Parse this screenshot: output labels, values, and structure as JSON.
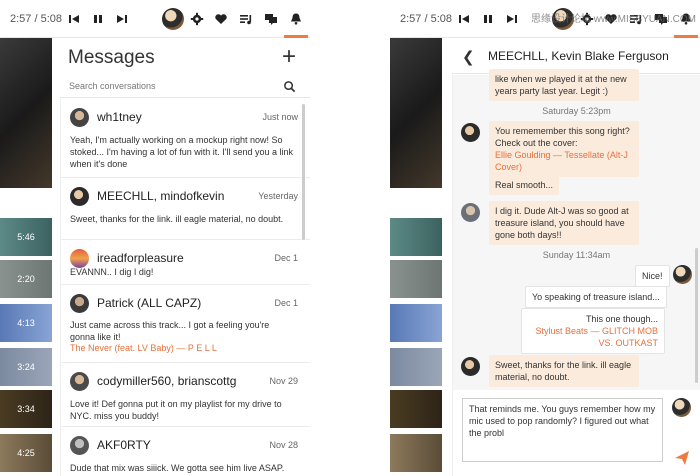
{
  "player": {
    "time_left": "2:57 / 5:08",
    "time_right": "2:57 / 5:08"
  },
  "watermark": "思缘设计论坛 www.MISSYUAN.COM",
  "strip_tiles": [
    "5:46",
    "2:20",
    "4:13",
    "3:24",
    "3:34",
    "4:25"
  ],
  "messages": {
    "title": "Messages",
    "add_label": "+",
    "search_placeholder": "Search conversations",
    "conversations": [
      {
        "name": "wh1tney",
        "date": "Just now",
        "preview": "Yeah, I'm actually working on a mockup right now! So stoked... I'm having a lot of fun with it. I'll send you a link when it's done",
        "link": ""
      },
      {
        "name": "MEECHLL, mindofkevin",
        "date": "Yesterday",
        "preview": "Sweet, thanks for the link. ill eagle material, no doubt.",
        "link": ""
      },
      {
        "name": "ireadforpleasure",
        "date": "Dec 1",
        "preview": "EVANNN.. I dig I dig!",
        "link": ""
      },
      {
        "name": "Patrick (ALL CAPZ)",
        "date": "Dec 1",
        "preview": "Just came across this track... I got a feeling you're gonna like it!",
        "link": "The Never (feat. LV Baby) — P E L L"
      },
      {
        "name": "codymiller560, brianscottg",
        "date": "Nov 29",
        "preview": "Love it! Def gonna put it on my playlist for my drive to NYC. miss you buddy!",
        "link": ""
      },
      {
        "name": "AKF0RTY",
        "date": "Nov 28",
        "preview": "Dude that mix was siiick. We gotta see him live ASAP.",
        "link": ""
      }
    ]
  },
  "chat": {
    "back_label": "❮",
    "title": "MEECHLL, Kevin Blake Ferguson",
    "msg0": "like when we played it at the new years party last year. Legit :)",
    "stamp1": "Saturday 5:23pm",
    "msg1": "You rememember this song right? Check out the cover:",
    "msg1_link": "Ellie Goulding — Tessellate (Alt-J Cover)",
    "msg2": "Real smooth...",
    "msg3": "I dig it. Dude Alt-J was so good at treasure island, you should have gone both days!!",
    "stamp2": "Sunday 11:34am",
    "msg4": "Nice!",
    "msg5": "Yo speaking of treasure island...",
    "msg6": "This one though...",
    "msg6_link": "Stylust Beats — GLITCH MOB VS. OUTKAST",
    "msg7": "Sweet, thanks for the link. ill eagle material, no doubt.",
    "compose_text": "That reminds me. You guys remember how my mic used to pop randomly? I figured out what the probl"
  },
  "colors": {
    "accent": "#ee7b41",
    "link": "#e6713b",
    "bubble_in": "#fbebdc"
  }
}
